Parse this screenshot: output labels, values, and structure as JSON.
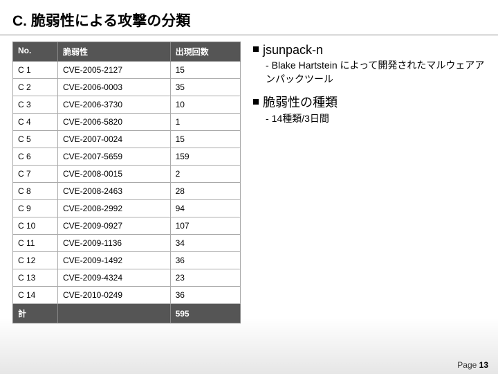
{
  "title": "C. 脆弱性による攻撃の分類",
  "table": {
    "headers": {
      "no": "No.",
      "vuln": "脆弱性",
      "count": "出現回数"
    },
    "rows": [
      {
        "no": "C 1",
        "vuln": "CVE-2005-2127",
        "count": "15"
      },
      {
        "no": "C 2",
        "vuln": "CVE-2006-0003",
        "count": "35"
      },
      {
        "no": "C 3",
        "vuln": "CVE-2006-3730",
        "count": "10"
      },
      {
        "no": "C 4",
        "vuln": "CVE-2006-5820",
        "count": "1"
      },
      {
        "no": "C 5",
        "vuln": "CVE-2007-0024",
        "count": "15"
      },
      {
        "no": "C 6",
        "vuln": "CVE-2007-5659",
        "count": "159"
      },
      {
        "no": "C 7",
        "vuln": "CVE-2008-0015",
        "count": "2"
      },
      {
        "no": "C 8",
        "vuln": "CVE-2008-2463",
        "count": "28"
      },
      {
        "no": "C 9",
        "vuln": "CVE-2008-2992",
        "count": "94"
      },
      {
        "no": "C 10",
        "vuln": "CVE-2009-0927",
        "count": "107"
      },
      {
        "no": "C 11",
        "vuln": "CVE-2009-1136",
        "count": "34"
      },
      {
        "no": "C 12",
        "vuln": "CVE-2009-1492",
        "count": "36"
      },
      {
        "no": "C 13",
        "vuln": "CVE-2009-4324",
        "count": "23"
      },
      {
        "no": "C 14",
        "vuln": "CVE-2010-0249",
        "count": "36"
      }
    ],
    "total": {
      "label": "計",
      "value": "595"
    }
  },
  "right": {
    "section1": {
      "title": "jsunpack-n",
      "sub": "Blake Hartstein によって開発されたマルウェアアンパックツール"
    },
    "section2": {
      "title": "脆弱性の種類",
      "sub": "14種類/3日間"
    }
  },
  "page": {
    "label": "Page ",
    "num": "13"
  }
}
